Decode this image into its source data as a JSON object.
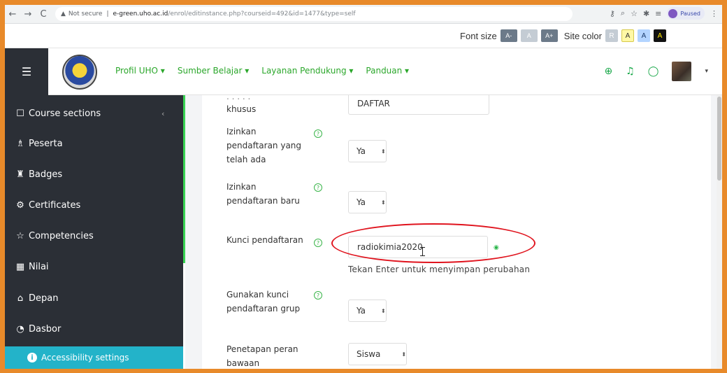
{
  "browser": {
    "back": "←",
    "forward": "→",
    "reload": "C",
    "security_warning": "Not secure",
    "url_host": "e-green.uho.ac.id",
    "url_path": "/enrol/editinstance.php?courseid=492&id=1477&type=self",
    "paused_label": "Paused"
  },
  "a11y_bar": {
    "font_size_label": "Font size",
    "font_dec": "A-",
    "font_reset": "A",
    "font_inc": "A+",
    "site_color_label": "Site color",
    "color_reset": "R",
    "color_yellow": "A",
    "color_blue": "A",
    "color_black": "A"
  },
  "navbar": {
    "menu": [
      "Profil UHO ▾",
      "Sumber Belajar ▾",
      "Layanan Pendukung ▾",
      "Panduan ▾"
    ],
    "icons": {
      "lang": "globe-icon",
      "notif": "bell-icon",
      "msg": "chat-icon"
    }
  },
  "sidebar": {
    "items": [
      {
        "label": "Course sections",
        "icon": "square-icon"
      },
      {
        "label": "Peserta",
        "icon": "users-icon"
      },
      {
        "label": "Badges",
        "icon": "badges-icon"
      },
      {
        "label": "Certificates",
        "icon": "certificate-icon"
      },
      {
        "label": "Competencies",
        "icon": "star-icon"
      },
      {
        "label": "Nilai",
        "icon": "table-icon"
      },
      {
        "label": "Depan",
        "icon": "home-icon"
      },
      {
        "label": "Dasbor",
        "icon": "gauge-icon"
      }
    ],
    "accessibility_settings": "Accessibility settings"
  },
  "form": {
    "instance_name_label": "khusus",
    "instance_name_value": "DAFTAR",
    "allow_existing_label": "Izinkan pendaftaran yang telah ada",
    "allow_existing_value": "Ya",
    "allow_new_label": "Izinkan pendaftaran baru",
    "allow_new_value": "Ya",
    "enrol_key_label": "Kunci pendaftaran",
    "enrol_key_value": "radiokimia2020",
    "enrol_key_hint": "Tekan Enter untuk menyimpan perubahan",
    "group_key_label": "Gunakan kunci pendaftaran grup",
    "group_key_value": "Ya",
    "default_role_label": "Penetapan peran bawaan",
    "default_role_value": "Siswa"
  },
  "colors": {
    "frame": "#e88a2a",
    "sidebar": "#2b2f36",
    "accent_green": "#39d353",
    "highlight": "#e0141e"
  }
}
